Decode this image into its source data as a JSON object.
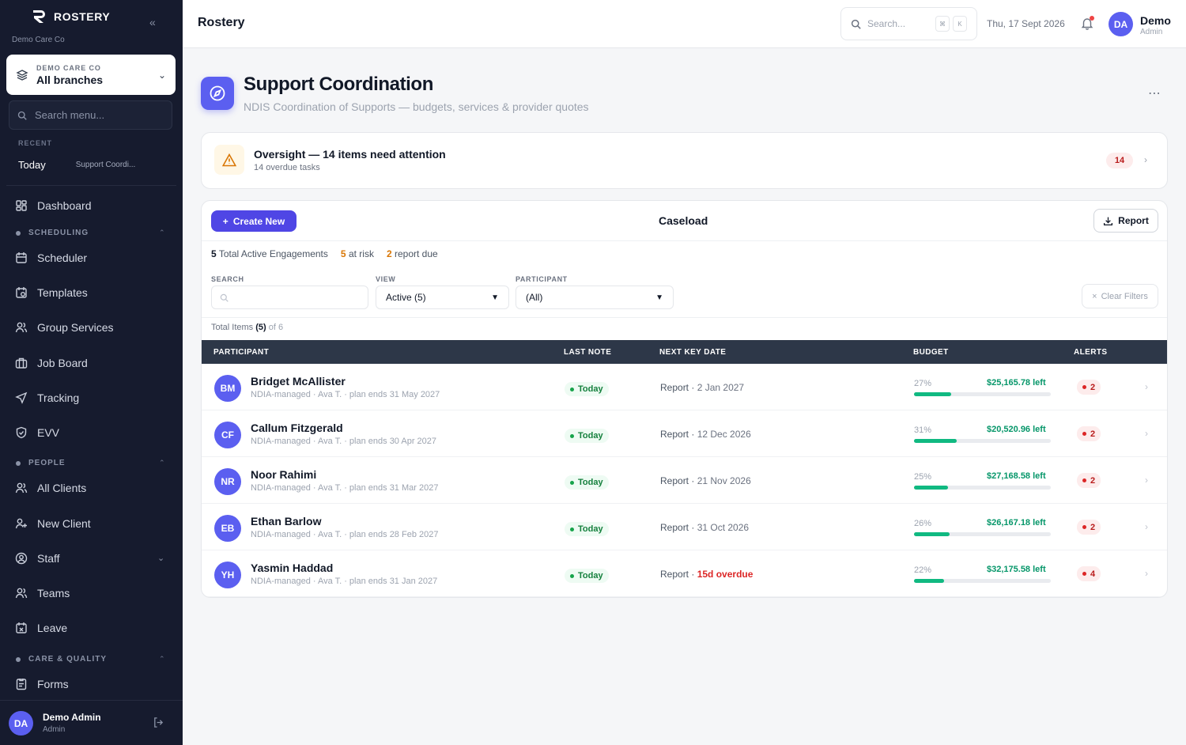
{
  "sidebar": {
    "brand": "ROSTERY",
    "org_name": "Demo Care Co",
    "org_card": {
      "kicker": "DEMO CARE CO",
      "value": "All branches"
    },
    "search_placeholder": "Search menu...",
    "recent": {
      "label": "RECENT",
      "today": "Today",
      "item": "Support Coordi..."
    },
    "items": [
      {
        "label": "Dashboard",
        "icon": "dashboard-icon"
      },
      {
        "label": "Scheduler",
        "icon": "calendar-icon"
      },
      {
        "label": "Templates",
        "icon": "template-icon"
      },
      {
        "label": "Group Services",
        "icon": "users-icon"
      },
      {
        "label": "Job Board",
        "icon": "briefcase-icon"
      },
      {
        "label": "Tracking",
        "icon": "navigation-icon"
      },
      {
        "label": "EVV",
        "icon": "shield-check-icon"
      },
      {
        "label": "All Clients",
        "icon": "users-icon"
      },
      {
        "label": "New Client",
        "icon": "user-plus-icon"
      },
      {
        "label": "Staff",
        "icon": "user-circle-icon"
      },
      {
        "label": "Teams",
        "icon": "team-icon"
      },
      {
        "label": "Leave",
        "icon": "calendar-x-icon"
      },
      {
        "label": "Forms",
        "icon": "form-icon"
      }
    ],
    "sections": {
      "scheduling": "SCHEDULING",
      "people": "PEOPLE",
      "care": "CARE & QUALITY"
    },
    "footer": {
      "initials": "DA",
      "name": "Demo Admin",
      "role": "Admin"
    }
  },
  "topbar": {
    "title": "Rostery",
    "search_placeholder": "Search...",
    "kbd1": "⌘",
    "kbd2": "K",
    "date": "Thu, 17 Sept 2026",
    "user": {
      "initials": "DA",
      "name": "Demo",
      "role": "Admin"
    }
  },
  "page": {
    "title": "Support Coordination",
    "subtitle": "NDIS Coordination of Supports — budgets, services & provider quotes"
  },
  "oversight": {
    "title": "Oversight — 14 items need attention",
    "subtitle": "14 overdue tasks",
    "badge": "14"
  },
  "caseload": {
    "create_label": "Create New",
    "title": "Caseload",
    "report_label": "Report",
    "stats": {
      "active_n": "5",
      "active_label": "Total Active Engagements",
      "risk_n": "5",
      "risk_label": "at risk",
      "due_n": "2",
      "due_label": "report due"
    },
    "filters": {
      "search_label": "SEARCH",
      "view_label": "VIEW",
      "view_value": "Active (5)",
      "participant_label": "PARTICIPANT",
      "participant_value": "(All)",
      "clear_label": "Clear Filters"
    },
    "total": {
      "prefix": "Total Items",
      "count": "(5)",
      "suffix": "of 6"
    },
    "columns": {
      "participant": "PARTICIPANT",
      "last_note": "LAST NOTE",
      "next_key": "NEXT KEY DATE",
      "budget": "BUDGET",
      "alerts": "ALERTS"
    },
    "rows": [
      {
        "initials": "BM",
        "name": "Bridget McAllister",
        "meta": "NDIA-managed · Ava T. · plan ends 31 May 2027",
        "last_note": "Today",
        "next_prefix": "Report ·",
        "next_date": "2 Jan 2027",
        "overdue": false,
        "pct_label": "27%",
        "pct": 27,
        "left": "$25,165.78 left",
        "alerts": "2"
      },
      {
        "initials": "CF",
        "name": "Callum Fitzgerald",
        "meta": "NDIA-managed · Ava T. · plan ends 30 Apr 2027",
        "last_note": "Today",
        "next_prefix": "Report ·",
        "next_date": "12 Dec 2026",
        "overdue": false,
        "pct_label": "31%",
        "pct": 31,
        "left": "$20,520.96 left",
        "alerts": "2"
      },
      {
        "initials": "NR",
        "name": "Noor Rahimi",
        "meta": "NDIA-managed · Ava T. · plan ends 31 Mar 2027",
        "last_note": "Today",
        "next_prefix": "Report ·",
        "next_date": "21 Nov 2026",
        "overdue": false,
        "pct_label": "25%",
        "pct": 25,
        "left": "$27,168.58 left",
        "alerts": "2"
      },
      {
        "initials": "EB",
        "name": "Ethan Barlow",
        "meta": "NDIA-managed · Ava T. · plan ends 28 Feb 2027",
        "last_note": "Today",
        "next_prefix": "Report ·",
        "next_date": "31 Oct 2026",
        "overdue": false,
        "pct_label": "26%",
        "pct": 26,
        "left": "$26,167.18 left",
        "alerts": "2"
      },
      {
        "initials": "YH",
        "name": "Yasmin Haddad",
        "meta": "NDIA-managed · Ava T. · plan ends 31 Jan 2027",
        "last_note": "Today",
        "next_prefix": "Report ·",
        "next_date": "15d overdue",
        "overdue": true,
        "pct_label": "22%",
        "pct": 22,
        "left": "$32,175.58 left",
        "alerts": "4"
      }
    ]
  },
  "colors": {
    "accent": "#5b5ff0",
    "sidebar": "#161b2e",
    "success": "#10b981",
    "danger": "#dc2626",
    "warning": "#d97706"
  }
}
